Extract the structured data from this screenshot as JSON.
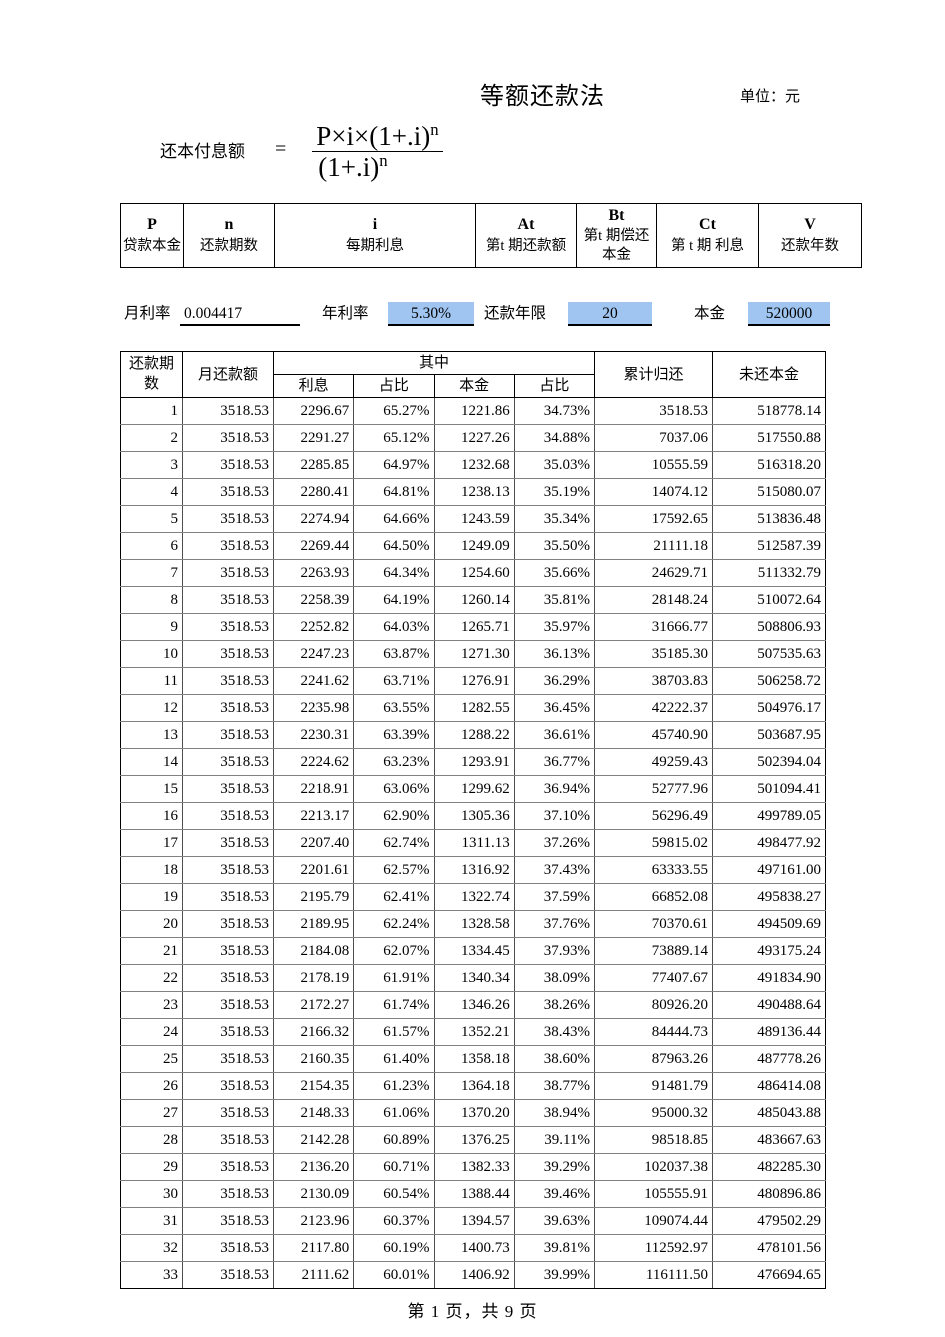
{
  "header": {
    "title": "等额还款法",
    "unit_label": "单位：元"
  },
  "formula": {
    "label": "还本付息额",
    "equals": "=",
    "numerator_base": "P×i×(1+.i)",
    "numerator_exp": "n",
    "denominator_base": "(1+.i)",
    "denominator_exp": "n"
  },
  "legend": {
    "columns": [
      {
        "symbol": "P",
        "desc": "贷款本金"
      },
      {
        "symbol": "n",
        "desc": "还款期数"
      },
      {
        "symbol": "i",
        "desc": "每期利息"
      },
      {
        "symbol": "At",
        "desc": "第t 期还款额"
      },
      {
        "symbol": "Bt",
        "desc": "第t 期偿还本金"
      },
      {
        "symbol": "Ct",
        "desc": "第 t 期  利息"
      },
      {
        "symbol": "V",
        "desc": "还款年数"
      }
    ]
  },
  "params": {
    "monthly_rate_label": "月利率",
    "monthly_rate_value": "0.004417",
    "annual_rate_label": "年利率",
    "annual_rate_value": "5.30%",
    "term_years_label": "还款年限",
    "term_years_value": "20",
    "principal_label": "本金",
    "principal_value": "520000",
    "highlight_color": "#9FC5F0"
  },
  "table": {
    "headers": {
      "period": "还款期数",
      "monthly_payment": "月还款额",
      "group_of_which": "其中",
      "interest": "利息",
      "interest_pct": "占比",
      "principal": "本金",
      "principal_pct": "占比",
      "cumulative_repaid": "累计归还",
      "remaining_principal": "未还本金"
    },
    "rows": [
      [
        "1",
        "3518.53",
        "2296.67",
        "65.27%",
        "1221.86",
        "34.73%",
        "3518.53",
        "518778.14"
      ],
      [
        "2",
        "3518.53",
        "2291.27",
        "65.12%",
        "1227.26",
        "34.88%",
        "7037.06",
        "517550.88"
      ],
      [
        "3",
        "3518.53",
        "2285.85",
        "64.97%",
        "1232.68",
        "35.03%",
        "10555.59",
        "516318.20"
      ],
      [
        "4",
        "3518.53",
        "2280.41",
        "64.81%",
        "1238.13",
        "35.19%",
        "14074.12",
        "515080.07"
      ],
      [
        "5",
        "3518.53",
        "2274.94",
        "64.66%",
        "1243.59",
        "35.34%",
        "17592.65",
        "513836.48"
      ],
      [
        "6",
        "3518.53",
        "2269.44",
        "64.50%",
        "1249.09",
        "35.50%",
        "21111.18",
        "512587.39"
      ],
      [
        "7",
        "3518.53",
        "2263.93",
        "64.34%",
        "1254.60",
        "35.66%",
        "24629.71",
        "511332.79"
      ],
      [
        "8",
        "3518.53",
        "2258.39",
        "64.19%",
        "1260.14",
        "35.81%",
        "28148.24",
        "510072.64"
      ],
      [
        "9",
        "3518.53",
        "2252.82",
        "64.03%",
        "1265.71",
        "35.97%",
        "31666.77",
        "508806.93"
      ],
      [
        "10",
        "3518.53",
        "2247.23",
        "63.87%",
        "1271.30",
        "36.13%",
        "35185.30",
        "507535.63"
      ],
      [
        "11",
        "3518.53",
        "2241.62",
        "63.71%",
        "1276.91",
        "36.29%",
        "38703.83",
        "506258.72"
      ],
      [
        "12",
        "3518.53",
        "2235.98",
        "63.55%",
        "1282.55",
        "36.45%",
        "42222.37",
        "504976.17"
      ],
      [
        "13",
        "3518.53",
        "2230.31",
        "63.39%",
        "1288.22",
        "36.61%",
        "45740.90",
        "503687.95"
      ],
      [
        "14",
        "3518.53",
        "2224.62",
        "63.23%",
        "1293.91",
        "36.77%",
        "49259.43",
        "502394.04"
      ],
      [
        "15",
        "3518.53",
        "2218.91",
        "63.06%",
        "1299.62",
        "36.94%",
        "52777.96",
        "501094.41"
      ],
      [
        "16",
        "3518.53",
        "2213.17",
        "62.90%",
        "1305.36",
        "37.10%",
        "56296.49",
        "499789.05"
      ],
      [
        "17",
        "3518.53",
        "2207.40",
        "62.74%",
        "1311.13",
        "37.26%",
        "59815.02",
        "498477.92"
      ],
      [
        "18",
        "3518.53",
        "2201.61",
        "62.57%",
        "1316.92",
        "37.43%",
        "63333.55",
        "497161.00"
      ],
      [
        "19",
        "3518.53",
        "2195.79",
        "62.41%",
        "1322.74",
        "37.59%",
        "66852.08",
        "495838.27"
      ],
      [
        "20",
        "3518.53",
        "2189.95",
        "62.24%",
        "1328.58",
        "37.76%",
        "70370.61",
        "494509.69"
      ],
      [
        "21",
        "3518.53",
        "2184.08",
        "62.07%",
        "1334.45",
        "37.93%",
        "73889.14",
        "493175.24"
      ],
      [
        "22",
        "3518.53",
        "2178.19",
        "61.91%",
        "1340.34",
        "38.09%",
        "77407.67",
        "491834.90"
      ],
      [
        "23",
        "3518.53",
        "2172.27",
        "61.74%",
        "1346.26",
        "38.26%",
        "80926.20",
        "490488.64"
      ],
      [
        "24",
        "3518.53",
        "2166.32",
        "61.57%",
        "1352.21",
        "38.43%",
        "84444.73",
        "489136.44"
      ],
      [
        "25",
        "3518.53",
        "2160.35",
        "61.40%",
        "1358.18",
        "38.60%",
        "87963.26",
        "487778.26"
      ],
      [
        "26",
        "3518.53",
        "2154.35",
        "61.23%",
        "1364.18",
        "38.77%",
        "91481.79",
        "486414.08"
      ],
      [
        "27",
        "3518.53",
        "2148.33",
        "61.06%",
        "1370.20",
        "38.94%",
        "95000.32",
        "485043.88"
      ],
      [
        "28",
        "3518.53",
        "2142.28",
        "60.89%",
        "1376.25",
        "39.11%",
        "98518.85",
        "483667.63"
      ],
      [
        "29",
        "3518.53",
        "2136.20",
        "60.71%",
        "1382.33",
        "39.29%",
        "102037.38",
        "482285.30"
      ],
      [
        "30",
        "3518.53",
        "2130.09",
        "60.54%",
        "1388.44",
        "39.46%",
        "105555.91",
        "480896.86"
      ],
      [
        "31",
        "3518.53",
        "2123.96",
        "60.37%",
        "1394.57",
        "39.63%",
        "109074.44",
        "479502.29"
      ],
      [
        "32",
        "3518.53",
        "2117.80",
        "60.19%",
        "1400.73",
        "39.81%",
        "112592.97",
        "478101.56"
      ],
      [
        "33",
        "3518.53",
        "2111.62",
        "60.01%",
        "1406.92",
        "39.99%",
        "116111.50",
        "476694.65"
      ]
    ]
  },
  "footer": {
    "text": "第 1 页，共 9 页"
  }
}
